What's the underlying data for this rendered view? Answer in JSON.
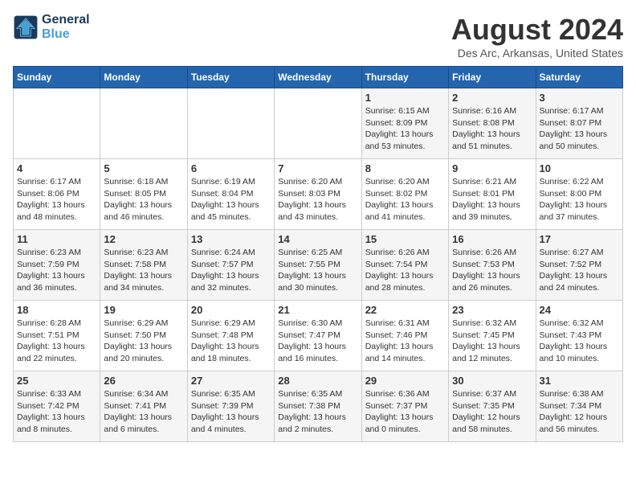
{
  "logo": {
    "line1": "General",
    "line2": "Blue"
  },
  "title": "August 2024",
  "location": "Des Arc, Arkansas, United States",
  "weekdays": [
    "Sunday",
    "Monday",
    "Tuesday",
    "Wednesday",
    "Thursday",
    "Friday",
    "Saturday"
  ],
  "weeks": [
    [
      {
        "day": "",
        "info": ""
      },
      {
        "day": "",
        "info": ""
      },
      {
        "day": "",
        "info": ""
      },
      {
        "day": "",
        "info": ""
      },
      {
        "day": "1",
        "info": "Sunrise: 6:15 AM\nSunset: 8:09 PM\nDaylight: 13 hours\nand 53 minutes."
      },
      {
        "day": "2",
        "info": "Sunrise: 6:16 AM\nSunset: 8:08 PM\nDaylight: 13 hours\nand 51 minutes."
      },
      {
        "day": "3",
        "info": "Sunrise: 6:17 AM\nSunset: 8:07 PM\nDaylight: 13 hours\nand 50 minutes."
      }
    ],
    [
      {
        "day": "4",
        "info": "Sunrise: 6:17 AM\nSunset: 8:06 PM\nDaylight: 13 hours\nand 48 minutes."
      },
      {
        "day": "5",
        "info": "Sunrise: 6:18 AM\nSunset: 8:05 PM\nDaylight: 13 hours\nand 46 minutes."
      },
      {
        "day": "6",
        "info": "Sunrise: 6:19 AM\nSunset: 8:04 PM\nDaylight: 13 hours\nand 45 minutes."
      },
      {
        "day": "7",
        "info": "Sunrise: 6:20 AM\nSunset: 8:03 PM\nDaylight: 13 hours\nand 43 minutes."
      },
      {
        "day": "8",
        "info": "Sunrise: 6:20 AM\nSunset: 8:02 PM\nDaylight: 13 hours\nand 41 minutes."
      },
      {
        "day": "9",
        "info": "Sunrise: 6:21 AM\nSunset: 8:01 PM\nDaylight: 13 hours\nand 39 minutes."
      },
      {
        "day": "10",
        "info": "Sunrise: 6:22 AM\nSunset: 8:00 PM\nDaylight: 13 hours\nand 37 minutes."
      }
    ],
    [
      {
        "day": "11",
        "info": "Sunrise: 6:23 AM\nSunset: 7:59 PM\nDaylight: 13 hours\nand 36 minutes."
      },
      {
        "day": "12",
        "info": "Sunrise: 6:23 AM\nSunset: 7:58 PM\nDaylight: 13 hours\nand 34 minutes."
      },
      {
        "day": "13",
        "info": "Sunrise: 6:24 AM\nSunset: 7:57 PM\nDaylight: 13 hours\nand 32 minutes."
      },
      {
        "day": "14",
        "info": "Sunrise: 6:25 AM\nSunset: 7:55 PM\nDaylight: 13 hours\nand 30 minutes."
      },
      {
        "day": "15",
        "info": "Sunrise: 6:26 AM\nSunset: 7:54 PM\nDaylight: 13 hours\nand 28 minutes."
      },
      {
        "day": "16",
        "info": "Sunrise: 6:26 AM\nSunset: 7:53 PM\nDaylight: 13 hours\nand 26 minutes."
      },
      {
        "day": "17",
        "info": "Sunrise: 6:27 AM\nSunset: 7:52 PM\nDaylight: 13 hours\nand 24 minutes."
      }
    ],
    [
      {
        "day": "18",
        "info": "Sunrise: 6:28 AM\nSunset: 7:51 PM\nDaylight: 13 hours\nand 22 minutes."
      },
      {
        "day": "19",
        "info": "Sunrise: 6:29 AM\nSunset: 7:50 PM\nDaylight: 13 hours\nand 20 minutes."
      },
      {
        "day": "20",
        "info": "Sunrise: 6:29 AM\nSunset: 7:48 PM\nDaylight: 13 hours\nand 18 minutes."
      },
      {
        "day": "21",
        "info": "Sunrise: 6:30 AM\nSunset: 7:47 PM\nDaylight: 13 hours\nand 16 minutes."
      },
      {
        "day": "22",
        "info": "Sunrise: 6:31 AM\nSunset: 7:46 PM\nDaylight: 13 hours\nand 14 minutes."
      },
      {
        "day": "23",
        "info": "Sunrise: 6:32 AM\nSunset: 7:45 PM\nDaylight: 13 hours\nand 12 minutes."
      },
      {
        "day": "24",
        "info": "Sunrise: 6:32 AM\nSunset: 7:43 PM\nDaylight: 13 hours\nand 10 minutes."
      }
    ],
    [
      {
        "day": "25",
        "info": "Sunrise: 6:33 AM\nSunset: 7:42 PM\nDaylight: 13 hours\nand 8 minutes."
      },
      {
        "day": "26",
        "info": "Sunrise: 6:34 AM\nSunset: 7:41 PM\nDaylight: 13 hours\nand 6 minutes."
      },
      {
        "day": "27",
        "info": "Sunrise: 6:35 AM\nSunset: 7:39 PM\nDaylight: 13 hours\nand 4 minutes."
      },
      {
        "day": "28",
        "info": "Sunrise: 6:35 AM\nSunset: 7:38 PM\nDaylight: 13 hours\nand 2 minutes."
      },
      {
        "day": "29",
        "info": "Sunrise: 6:36 AM\nSunset: 7:37 PM\nDaylight: 13 hours\nand 0 minutes."
      },
      {
        "day": "30",
        "info": "Sunrise: 6:37 AM\nSunset: 7:35 PM\nDaylight: 12 hours\nand 58 minutes."
      },
      {
        "day": "31",
        "info": "Sunrise: 6:38 AM\nSunset: 7:34 PM\nDaylight: 12 hours\nand 56 minutes."
      }
    ]
  ]
}
